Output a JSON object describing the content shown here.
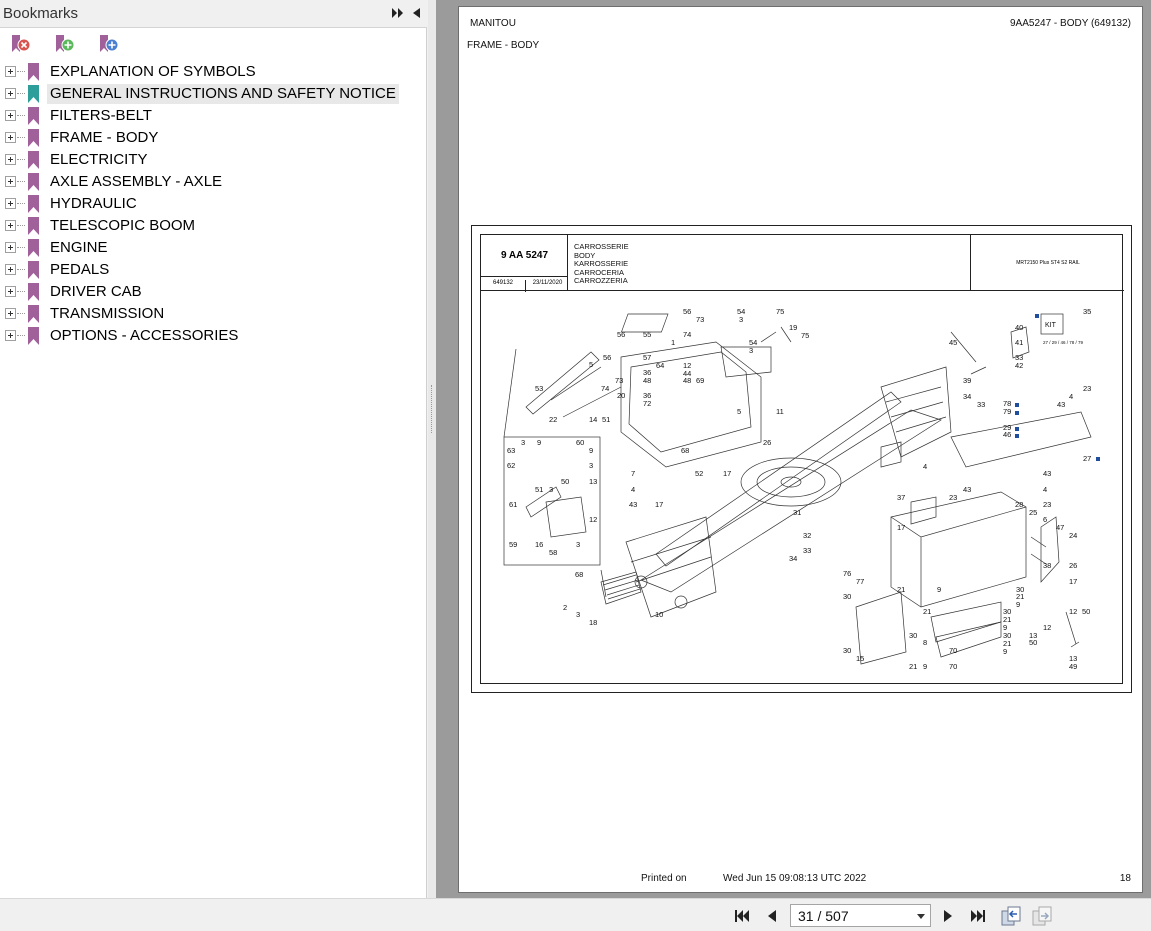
{
  "sidebar": {
    "title": "Bookmarks",
    "bookmarks": [
      {
        "label": "EXPLANATION OF SYMBOLS",
        "selected": false
      },
      {
        "label": "GENERAL INSTRUCTIONS AND SAFETY NOTICE",
        "selected": true
      },
      {
        "label": "FILTERS-BELT",
        "selected": false
      },
      {
        "label": "FRAME - BODY",
        "selected": false
      },
      {
        "label": "ELECTRICITY",
        "selected": false
      },
      {
        "label": "AXLE ASSEMBLY - AXLE",
        "selected": false
      },
      {
        "label": "HYDRAULIC",
        "selected": false
      },
      {
        "label": "TELESCOPIC BOOM",
        "selected": false
      },
      {
        "label": "ENGINE",
        "selected": false
      },
      {
        "label": "PEDALS",
        "selected": false
      },
      {
        "label": "DRIVER CAB",
        "selected": false
      },
      {
        "label": "TRANSMISSION",
        "selected": false
      },
      {
        "label": "OPTIONS - ACCESSORIES",
        "selected": false
      }
    ],
    "icons": [
      "delete-bookmark-icon",
      "add-bookmark-icon",
      "add-child-bookmark-icon"
    ],
    "colors": {
      "bookmark": "#a0609a",
      "bookmark_selected": "#2e9e9a"
    }
  },
  "page": {
    "brand": "MANITOU",
    "reference": "9AA5247 - BODY (649132)",
    "section": "FRAME - BODY",
    "title_block": {
      "code": "9 AA 5247",
      "id": "649132",
      "date": "23/11/2020",
      "languages": [
        "CARROSSERIE",
        "BODY",
        "KARROSSERIE",
        "CARROCERIA",
        "CARROZZERIA"
      ],
      "model": "MRT2150 Plus ST4 S2 RAIL"
    },
    "kit_label": "KIT",
    "kit_parts": "27 / 29 / 46 / 78 / 79",
    "printed_label": "Printed on",
    "printed_value": "Wed Jun 15 09:08:13 UTC 2022",
    "page_number": "18"
  },
  "navbar": {
    "page_indicator": "31 / 507",
    "icons": [
      "first-page-icon",
      "previous-page-icon",
      "next-page-icon",
      "last-page-icon",
      "go-back-icon",
      "go-forward-icon"
    ]
  }
}
